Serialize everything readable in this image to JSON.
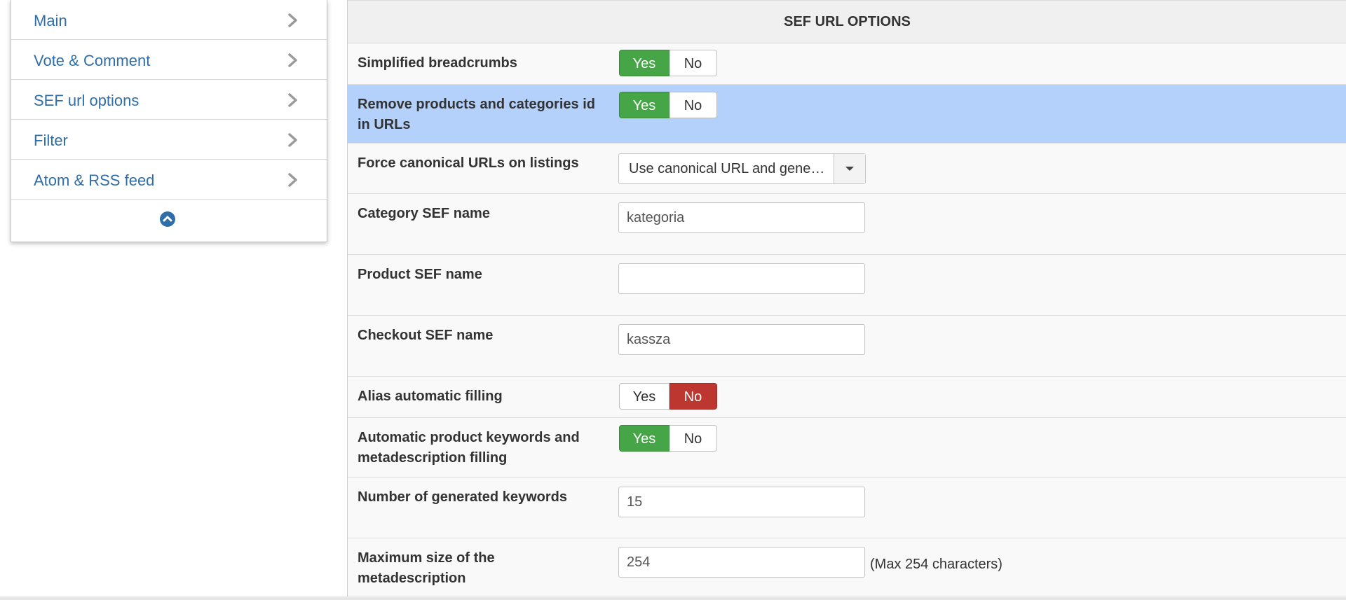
{
  "sidebar": {
    "items": [
      {
        "label": "Main"
      },
      {
        "label": "Vote & Comment"
      },
      {
        "label": "SEF url options"
      },
      {
        "label": "Filter"
      },
      {
        "label": "Atom & RSS feed"
      }
    ],
    "collapse_icon": "chevron-up-circle-icon"
  },
  "panel": {
    "title": "SEF URL OPTIONS",
    "yes_label": "Yes",
    "no_label": "No",
    "colors": {
      "yes_active": "#46a546",
      "no_active": "#bd362f",
      "highlight_row": "#b3d1fb"
    },
    "fields": {
      "simplified_breadcrumbs": {
        "label": "Simplified breadcrumbs",
        "value": "Yes"
      },
      "remove_ids": {
        "label": "Remove products and categories id in URLs",
        "value": "Yes"
      },
      "force_canonical": {
        "label": "Force canonical URLs on listings",
        "value": "Use canonical URL and gene…"
      },
      "category_sef": {
        "label": "Category SEF name",
        "value": "kategoria"
      },
      "product_sef": {
        "label": "Product SEF name",
        "value": ""
      },
      "checkout_sef": {
        "label": "Checkout SEF name",
        "value": "kassza"
      },
      "alias_filling": {
        "label": "Alias automatic filling",
        "value": "No"
      },
      "auto_keywords": {
        "label": "Automatic product keywords and metadescription filling",
        "value": "Yes"
      },
      "num_keywords": {
        "label": "Number of generated keywords",
        "value": "15"
      },
      "max_meta": {
        "label": "Maximum size of the metadescription",
        "value": "254",
        "hint": "(Max 254 characters)"
      }
    }
  }
}
